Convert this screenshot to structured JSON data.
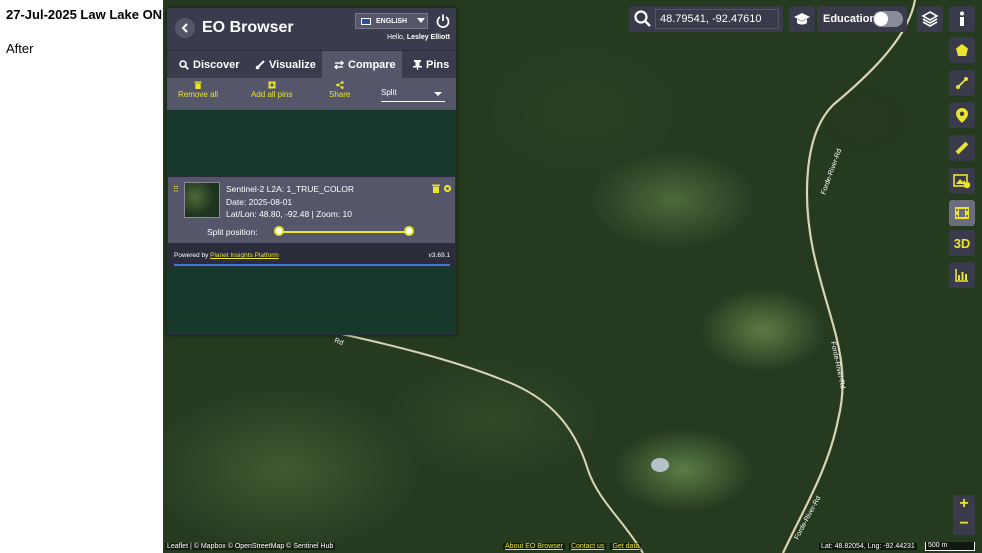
{
  "caption": {
    "title": "27-Jul-2025 Law Lake ON",
    "subtitle": "After"
  },
  "header": {
    "brand": "EO Browser",
    "language": "ENGLISH",
    "hello_prefix": "Hello,",
    "user_name": "Lesley Elliott"
  },
  "tabs": [
    {
      "label": "Discover",
      "icon": "search-icon"
    },
    {
      "label": "Visualize",
      "icon": "brush-icon"
    },
    {
      "label": "Compare",
      "icon": "swap-arrows-icon",
      "active": true
    },
    {
      "label": "Pins",
      "icon": "pin-icon"
    }
  ],
  "compare_actions": {
    "remove_all": "Remove all",
    "add_all_pins": "Add all pins",
    "share": "Share",
    "mode_value": "Split"
  },
  "layer": {
    "title": "Sentinel-2 L2A: 1_TRUE_COLOR",
    "date": "Date: 2025-08-01",
    "latlon": "Lat/Lon: 48.80, -92.48 | Zoom: 10",
    "split_label": "Split position:",
    "split_range": [
      0,
      1
    ]
  },
  "footer": {
    "powered_by": "Powered by",
    "platform_link": "Planet Insights Platform",
    "version": "v3.69.1",
    "progress": 1.0
  },
  "search": {
    "value": "48.79541, -92.47610"
  },
  "education": {
    "label": "Education",
    "enabled": false
  },
  "right_toolbar": [
    "pentagon-icon",
    "measure-line-icon",
    "location-pin-icon",
    "ruler-icon",
    "image-download-icon",
    "film-icon",
    "3D",
    "chart-icon"
  ],
  "right_toolbar_text": {
    "three_d": "3D"
  },
  "zoom": {
    "in": "+",
    "out": "−"
  },
  "attribution": {
    "leaflet": "Leaflet",
    "mapbox": "Mapbox",
    "osm": "OpenStreetMap",
    "sentinel_hub": "Sentinel Hub",
    "about": "About EO Browser",
    "contact": "Contact us",
    "get_data": "Get data",
    "cursor_coords": "Lat: 48.82054, Lng: -92.44231",
    "scale": "500 m"
  },
  "map_labels": {
    "road_upper": "Forde-River-Rd",
    "road_lower": "Forde-River-Rd",
    "road_mid": "Forde-River-Rd",
    "road_west": "Rd"
  },
  "colors": {
    "accent": "#eae42a",
    "panel": "#2b2d3d",
    "panel_light": "#55566a",
    "map_dark": "#17392b"
  }
}
